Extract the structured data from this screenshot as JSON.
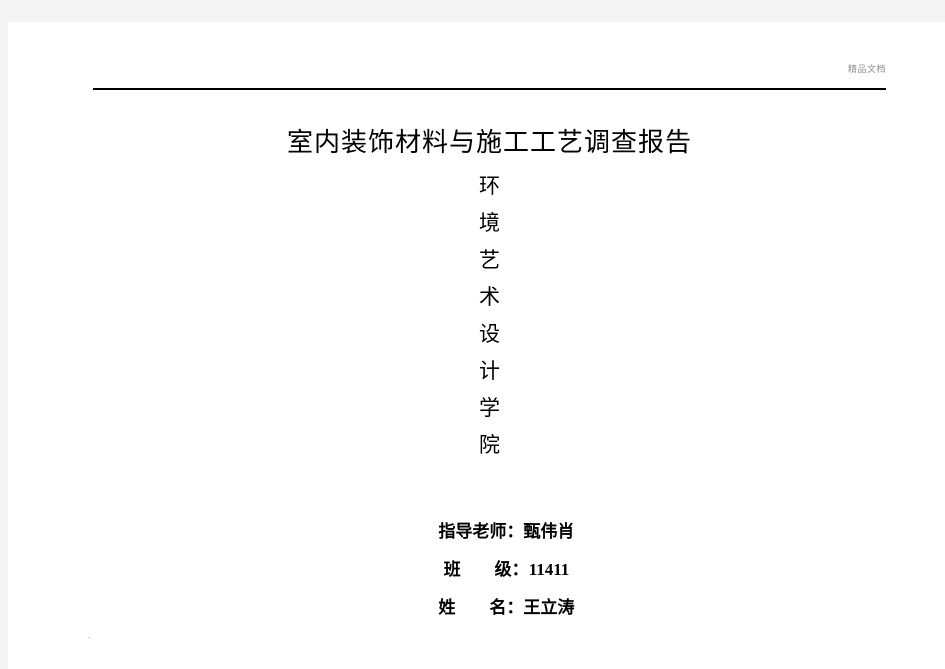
{
  "page": {
    "background_color": "#ffffff",
    "canvas_color": "#f4f4f4"
  },
  "header": {
    "watermark": "精品文档",
    "watermark_color": "#8c8c8c",
    "rule_color": "#000000"
  },
  "document": {
    "title": "室内装饰材料与施工工艺调查报告",
    "vertical_heading": {
      "full_text": "环境艺术设计学院",
      "characters": [
        "环",
        "境",
        "艺",
        "术",
        "设",
        "计",
        "学",
        "院"
      ]
    },
    "meta": [
      {
        "label": "指导老师：",
        "value": "甄伟肖"
      },
      {
        "label": "班　　级：",
        "value": "11411"
      },
      {
        "label": "姓　　名：",
        "value": "王立涛"
      }
    ]
  },
  "footer": {
    "mark": "."
  }
}
